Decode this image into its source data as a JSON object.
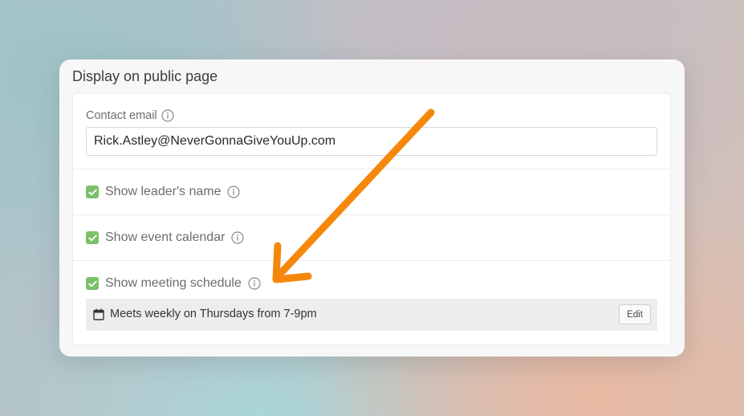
{
  "panel": {
    "title": "Display on public page",
    "contact": {
      "label": "Contact email",
      "value": "Rick.Astley@NeverGonnaGiveYouUp.com",
      "info_icon": "info-icon"
    },
    "options": [
      {
        "label": "Show leader's name",
        "checked": true
      },
      {
        "label": "Show event calendar",
        "checked": true
      },
      {
        "label": "Show meeting schedule",
        "checked": true
      }
    ],
    "schedule": {
      "icon": "calendar-icon",
      "text": "Meets weekly on Thursdays from 7-9pm",
      "edit_label": "Edit"
    }
  },
  "colors": {
    "checkbox": "#7bbf6a",
    "arrow": "#f5880c"
  }
}
